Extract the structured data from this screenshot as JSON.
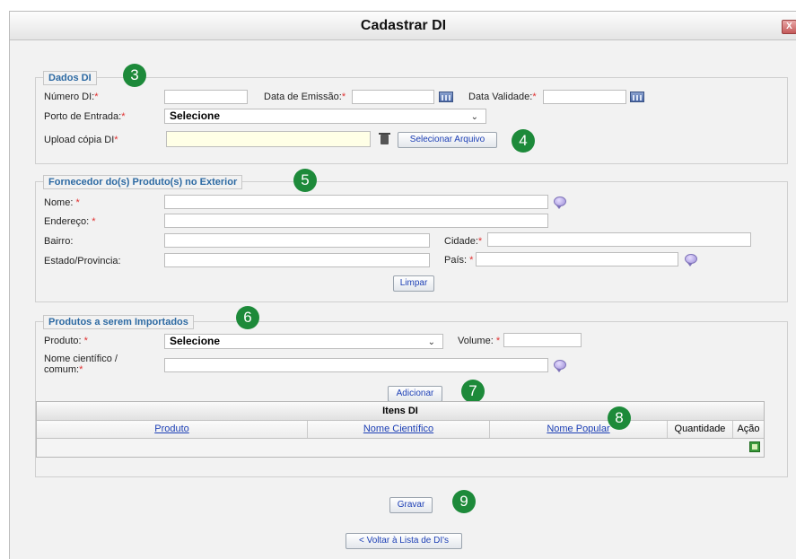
{
  "window": {
    "title": "Cadastrar DI",
    "close_label": "X"
  },
  "dados_di": {
    "legend": "Dados DI",
    "numero_label": "Número DI:",
    "emissao_label": "Data de Emissão:",
    "validade_label": "Data Validade:",
    "porto_label": "Porto de Entrada:",
    "porto_value": "Selecione",
    "upload_label": "Upload cópia DI",
    "select_file_button": "Selecionar Arquivo"
  },
  "fornecedor": {
    "legend": "Fornecedor do(s) Produto(s) no Exterior",
    "nome_label": "Nome:",
    "endereco_label": "Endereço:",
    "bairro_label": "Bairro:",
    "cidade_label": "Cidade:",
    "estado_label": "Estado/Provincia:",
    "pais_label": "País:",
    "limpar_button": "Limpar"
  },
  "produtos": {
    "legend": "Produtos a serem Importados",
    "produto_label": "Produto:",
    "produto_value": "Selecione",
    "volume_label": "Volume:",
    "nome_cientifico_label_1": "Nome científico /",
    "nome_cientifico_label_2": "comum:",
    "adicionar_button": "Adicionar"
  },
  "itens_di": {
    "title": "Itens DI",
    "columns": [
      "Produto",
      "Nome Científico",
      "Nome Popular",
      "Quantidade",
      "Ação"
    ]
  },
  "footer": {
    "gravar_button": "Gravar",
    "voltar_button": "< Voltar à Lista de DI's"
  },
  "annotations": [
    "3",
    "4",
    "5",
    "6",
    "7",
    "8",
    "9"
  ],
  "colors": {
    "badge": "#1d8a3a",
    "legend_text": "#2d6aa3",
    "link": "#1c3fb5",
    "required": "#e03030"
  }
}
